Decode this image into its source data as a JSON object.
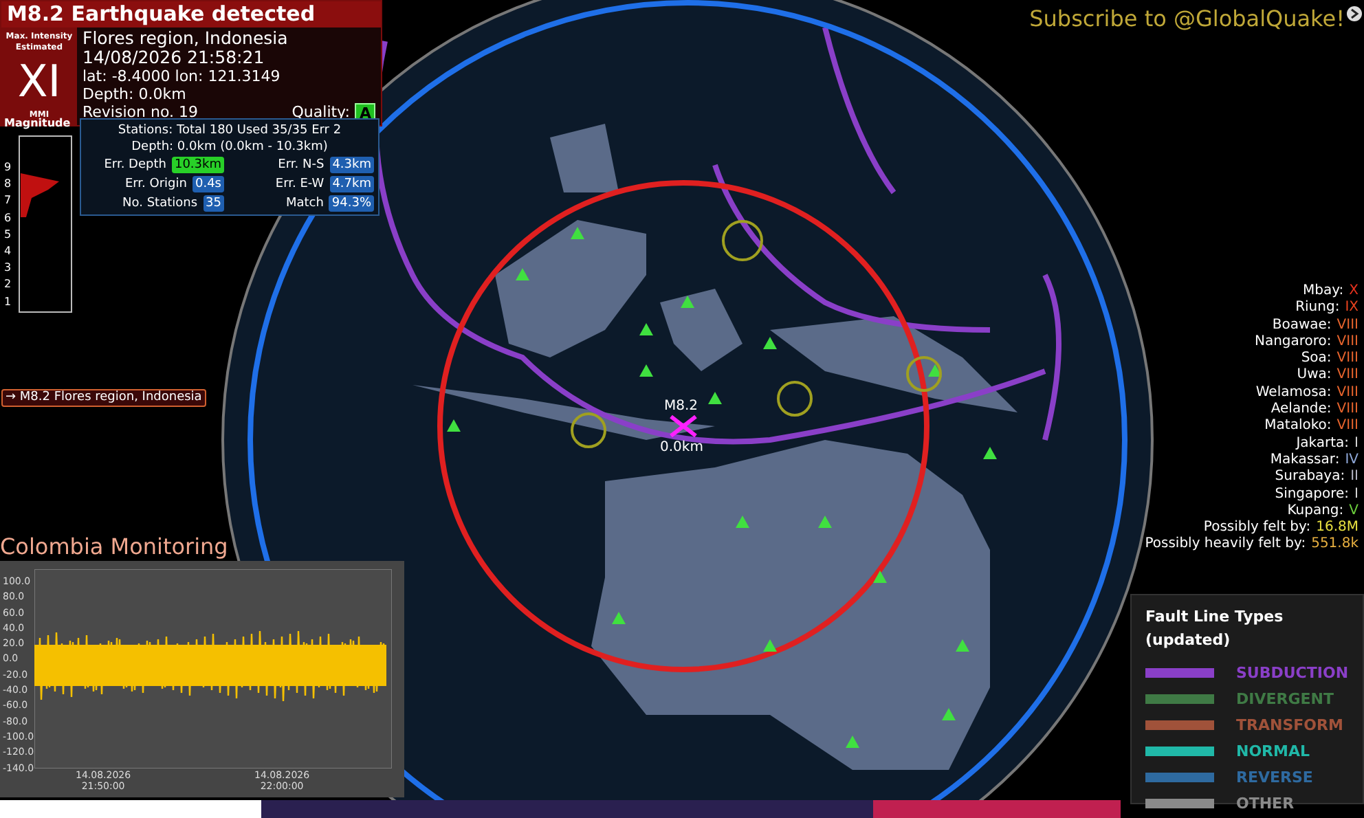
{
  "alert": {
    "title": "M8.2 Earthquake detected",
    "intensity_caption": "Max. Intensity Estimated",
    "intensity": "XI",
    "intensity_scale": "MMI",
    "region": "Flores region, Indonesia",
    "time": "14/08/2026 21:58:21",
    "coordinates": "lat: -8.4000 lon: 121.3149",
    "depth": "Depth: 0.0km",
    "revision": "Revision no. 19",
    "quality_label": "Quality:",
    "quality": "A"
  },
  "magnitude_histogram": {
    "title": "Magnitude",
    "ticks": [
      "9",
      "8",
      "7",
      "6",
      "5",
      "4",
      "3",
      "2",
      "1"
    ]
  },
  "details": {
    "line_1": "Stations: Total 180 Used 35/35 Err 2",
    "line_2": "Depth: 0.0km (0.0km - 10.3km)",
    "stats": [
      {
        "label": "Err. Depth",
        "value": "10.3km",
        "kind": "good"
      },
      {
        "label": "Err. N-S",
        "value": "4.3km",
        "kind": "normal"
      },
      {
        "label": "Err. Origin",
        "value": "0.4s",
        "kind": "normal"
      },
      {
        "label": "Err. E-W",
        "value": "4.7km",
        "kind": "normal"
      },
      {
        "label": "No. Stations",
        "value": "35",
        "kind": "normal"
      },
      {
        "label": "Match",
        "value": "94.3%",
        "kind": "normal"
      }
    ]
  },
  "subscribe": "Subscribe to @GlobalQuake!",
  "event_tag": "→ M8.2 Flores region, Indonesia",
  "epicenter": {
    "magnitude": "M8.2",
    "depth": "0.0km"
  },
  "intensities": [
    {
      "city": "Mbay:",
      "level": "X",
      "color": "#e8321e"
    },
    {
      "city": "Riung:",
      "level": "IX",
      "color": "#e8421e"
    },
    {
      "city": "Boawae:",
      "level": "VIII",
      "color": "#e8642d"
    },
    {
      "city": "Nangaroro:",
      "level": "VIII",
      "color": "#e8642d"
    },
    {
      "city": "Soa:",
      "level": "VIII",
      "color": "#e8642d"
    },
    {
      "city": "Uwa:",
      "level": "VIII",
      "color": "#e8642d"
    },
    {
      "city": "Welamosa:",
      "level": "VIII",
      "color": "#e8642d"
    },
    {
      "city": "Aelande:",
      "level": "VIII",
      "color": "#e8642d"
    },
    {
      "city": "Mataloko:",
      "level": "VIII",
      "color": "#e8642d"
    },
    {
      "city": "Jakarta:",
      "level": "I",
      "color": "#d8d8d8"
    },
    {
      "city": "Makassar:",
      "level": "IV",
      "color": "#8fa8d8"
    },
    {
      "city": "Surabaya:",
      "level": "II",
      "color": "#b8b8c8"
    },
    {
      "city": "Singapore:",
      "level": "I",
      "color": "#d8d8d8"
    },
    {
      "city": "Kupang:",
      "level": "V",
      "color": "#6ccf3c"
    }
  ],
  "felt": [
    {
      "label": "Possibly felt by:",
      "value": "16.8M",
      "color": "#e8e040"
    },
    {
      "label": "Possibly heavily felt by:",
      "value": "551.8k",
      "color": "#e8b040"
    }
  ],
  "monitor": {
    "title": "Colombia Monitoring",
    "y_labels": [
      "100.0",
      "80.0",
      "60.0",
      "40.0",
      "20.0",
      "0.0",
      "-20.0",
      "-40.0",
      "-60.0",
      "-80.0",
      "-100.0",
      "-120.0",
      "-140.0"
    ],
    "x_labels": [
      [
        "14.08.2026",
        "21:50:00"
      ],
      [
        "14.08.2026",
        "22:00:00"
      ]
    ]
  },
  "legend": {
    "title": "Fault Line Types (updated)",
    "items": [
      {
        "label": "SUBDUCTION",
        "color": "#8a3fc8"
      },
      {
        "label": "DIVERGENT",
        "color": "#3f7a45"
      },
      {
        "label": "TRANSFORM",
        "color": "#a0523a"
      },
      {
        "label": "NORMAL",
        "color": "#20b8a8"
      },
      {
        "label": "REVERSE",
        "color": "#2e6aa0"
      },
      {
        "label": "OTHER",
        "color": "#8a8a8a"
      }
    ]
  }
}
